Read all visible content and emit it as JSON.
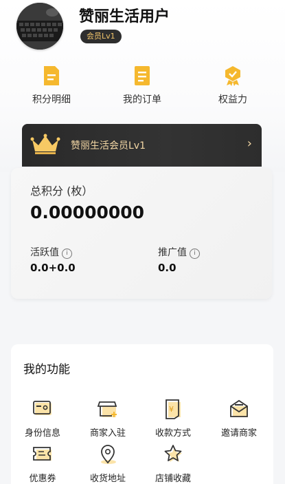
{
  "profile": {
    "username": "赞丽生活用户",
    "member_tag": "会员Lv1"
  },
  "quick_actions": [
    {
      "label": "积分明细",
      "icon": "points-detail-icon"
    },
    {
      "label": "我的订单",
      "icon": "order-icon"
    },
    {
      "label": "权益力",
      "icon": "rights-badge-icon"
    }
  ],
  "vip_banner": {
    "text": "赞丽生活会员Lv1",
    "arrow": "›",
    "icon": "crown-icon"
  },
  "points_card": {
    "title": "总积分 (枚）",
    "total": "0.00000000",
    "activity_label": "活跃值",
    "activity_value": "0.0+0.0",
    "promo_label": "推广值",
    "promo_value": "0.0"
  },
  "functions": {
    "title": "我的功能",
    "items": [
      {
        "label": "身份信息",
        "icon": "id-card-icon"
      },
      {
        "label": "商家入驻",
        "icon": "store-add-icon"
      },
      {
        "label": "收款方式",
        "icon": "payment-method-icon"
      },
      {
        "label": "邀请商家",
        "icon": "invite-mail-icon"
      },
      {
        "label": "优惠券",
        "icon": "coupon-icon"
      },
      {
        "label": "收货地址",
        "icon": "location-pin-icon"
      },
      {
        "label": "店铺收藏",
        "icon": "star-favorite-icon"
      }
    ]
  },
  "colors": {
    "accent_yellow": "#f5b82e",
    "dark_banner": "#2e2e2e",
    "gold_text": "#f5d9a6"
  }
}
